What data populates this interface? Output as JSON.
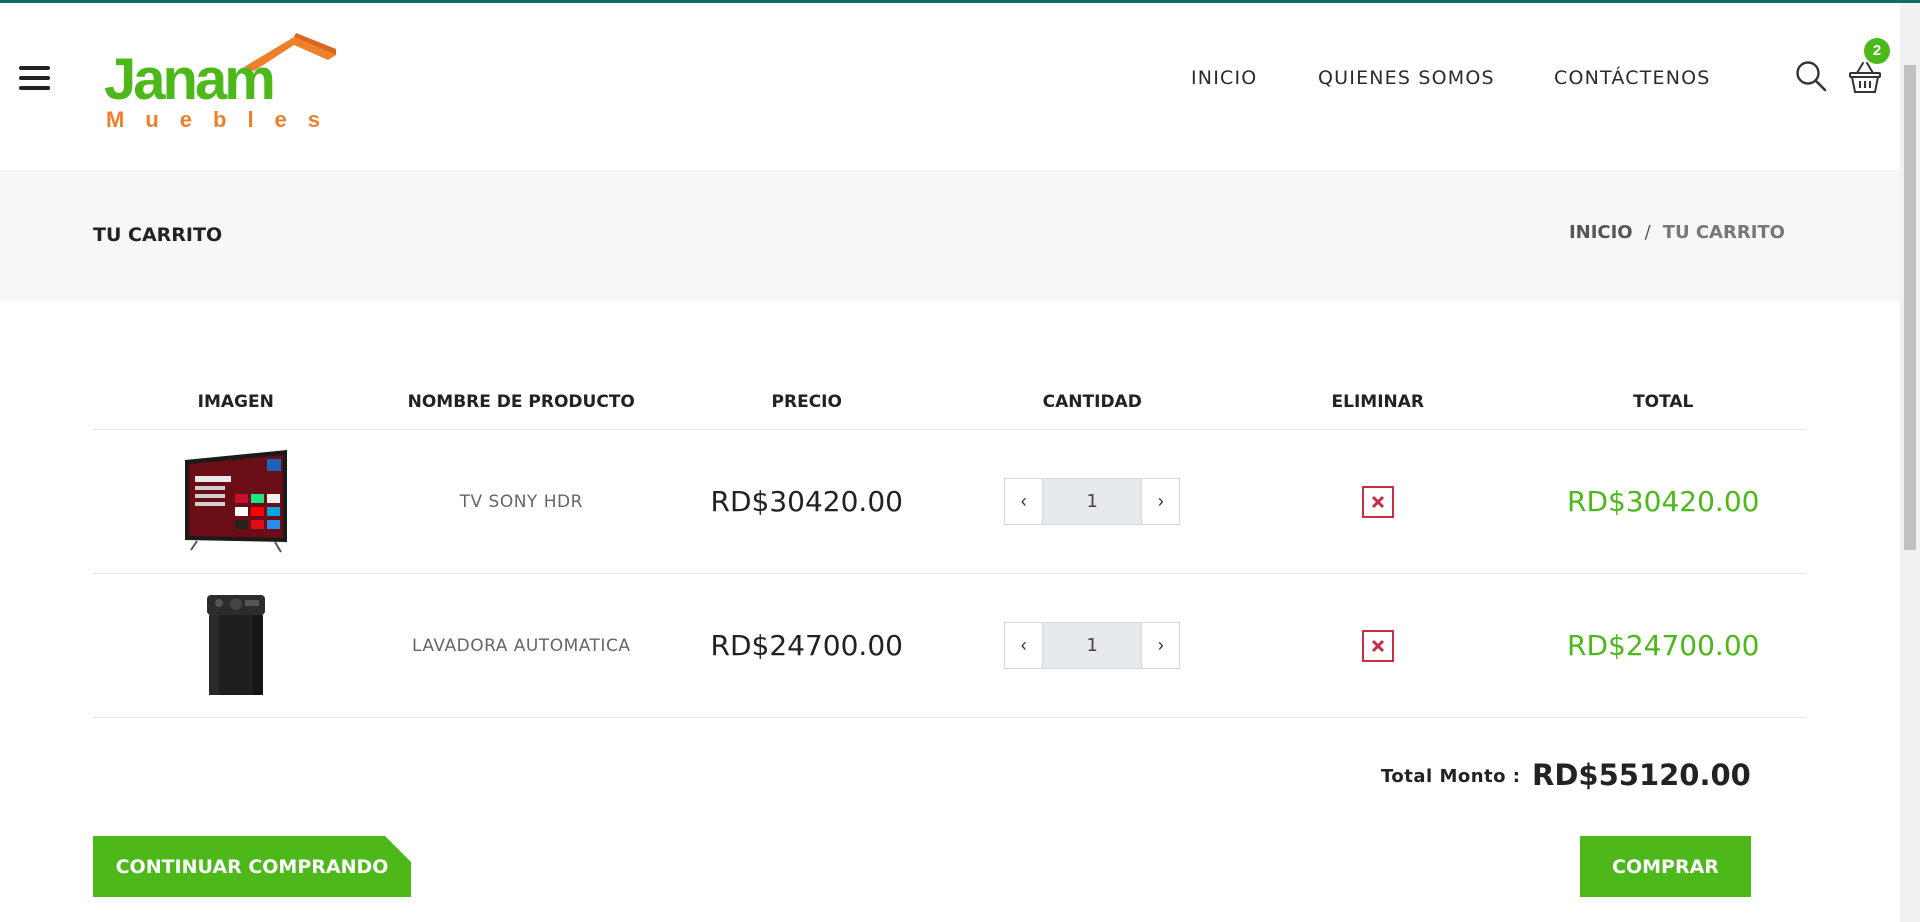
{
  "brand": {
    "name": "Janam",
    "tagline": "Muebles"
  },
  "nav": {
    "items": [
      "INICIO",
      "QUIENES SOMOS",
      "CONTÁCTENOS"
    ]
  },
  "header": {
    "cart_count": "2"
  },
  "page": {
    "title": "TU CARRITO",
    "breadcrumb": {
      "home": "INICIO",
      "separator": "/",
      "current": "TU CARRITO"
    }
  },
  "cart": {
    "columns": [
      "IMAGEN",
      "NOMBRE DE PRODUCTO",
      "PRECIO",
      "CANTIDAD",
      "ELIMINAR",
      "TOTAL"
    ],
    "items": [
      {
        "name": "TV SONY HDR",
        "price": "RD$30420.00",
        "quantity": "1",
        "total": "RD$30420.00",
        "image_icon": "tv-image"
      },
      {
        "name": "LAVADORA AUTOMATICA",
        "price": "RD$24700.00",
        "quantity": "1",
        "total": "RD$24700.00",
        "image_icon": "washer-image"
      }
    ],
    "summary_label": "Total Monto :",
    "summary_amount": "RD$55120.00"
  },
  "actions": {
    "continue_label": "CONTINUAR COMPRANDO",
    "buy_label": "COMPRAR"
  },
  "colors": {
    "accent": "#4cb81a",
    "logo_orange": "#f07f2b",
    "delete_red": "#c62f43",
    "topline": "#136a63"
  }
}
